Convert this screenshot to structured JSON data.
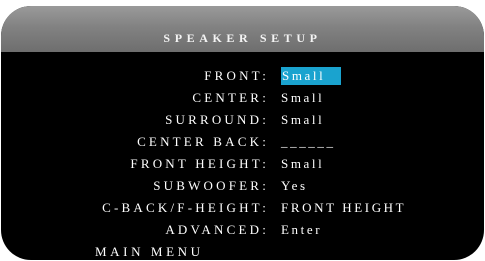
{
  "title": "SPEAKER SETUP",
  "rows": [
    {
      "label": "FRONT",
      "value": "Small"
    },
    {
      "label": "CENTER",
      "value": "Small"
    },
    {
      "label": "SURROUND",
      "value": "Small"
    },
    {
      "label": "CENTER BACK",
      "value": "______"
    },
    {
      "label": "FRONT HEIGHT",
      "value": "Small"
    },
    {
      "label": "SUBWOOFER",
      "value": "Yes"
    },
    {
      "label": "C-BACK/F-HEIGHT",
      "value": "FRONT HEIGHT"
    },
    {
      "label": "ADVANCED",
      "value": "Enter"
    }
  ],
  "separator": ":",
  "selected_row": "FRONT",
  "main_menu": "MAIN MENU",
  "colors": {
    "highlight": "#1aa3cf",
    "background": "#000000",
    "title_bar": "#828282"
  }
}
